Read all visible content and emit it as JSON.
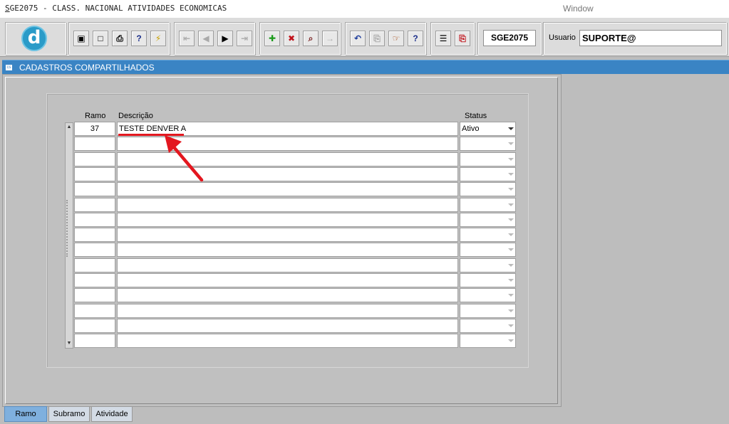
{
  "titlebar": {
    "title_prefix": "S",
    "title_rest": "GE2075 - CLASS. NACIONAL ATIVIDADES ECONOMICAS",
    "menu_window": "Window"
  },
  "toolbar": {
    "logo_letter": "d",
    "form_code": "SGE2075",
    "user_label": "Usuario",
    "user_value": "SUPORTE@",
    "buttons": {
      "save": "▣",
      "print_preview": "□",
      "print": "⎙",
      "help_q": "?",
      "magic": "⚡",
      "first": "⇤",
      "prev": "◀",
      "next": "▶",
      "last": "⇥",
      "insert": "✚",
      "delete": "✖",
      "query": "⌕",
      "clear": "→",
      "undo": "↶",
      "copy": "⎘",
      "hand": "☞",
      "help": "?",
      "menu": "☰",
      "exit": "⎘"
    }
  },
  "window": {
    "header_icon": "cs",
    "header_title": "CADASTROS COMPARTILHADOS"
  },
  "grid": {
    "headers": {
      "ramo": "Ramo",
      "descricao": "Descrição",
      "status": "Status"
    },
    "rows": [
      {
        "ramo": "37",
        "descricao": "TESTE DENVER A",
        "status": "Ativo"
      },
      {
        "ramo": "",
        "descricao": "",
        "status": ""
      },
      {
        "ramo": "",
        "descricao": "",
        "status": ""
      },
      {
        "ramo": "",
        "descricao": "",
        "status": ""
      },
      {
        "ramo": "",
        "descricao": "",
        "status": ""
      },
      {
        "ramo": "",
        "descricao": "",
        "status": ""
      },
      {
        "ramo": "",
        "descricao": "",
        "status": ""
      },
      {
        "ramo": "",
        "descricao": "",
        "status": ""
      },
      {
        "ramo": "",
        "descricao": "",
        "status": ""
      },
      {
        "ramo": "",
        "descricao": "",
        "status": ""
      },
      {
        "ramo": "",
        "descricao": "",
        "status": ""
      },
      {
        "ramo": "",
        "descricao": "",
        "status": ""
      },
      {
        "ramo": "",
        "descricao": "",
        "status": ""
      },
      {
        "ramo": "",
        "descricao": "",
        "status": ""
      },
      {
        "ramo": "",
        "descricao": "",
        "status": ""
      }
    ]
  },
  "tabs": [
    {
      "label": "Ramo",
      "active": true
    },
    {
      "label": "Subramo",
      "active": false
    },
    {
      "label": "Atividade",
      "active": false
    }
  ],
  "colors": {
    "header_bar": "#3a84c4",
    "annotation_red": "#e3171f",
    "active_tab": "#7fb0de"
  }
}
